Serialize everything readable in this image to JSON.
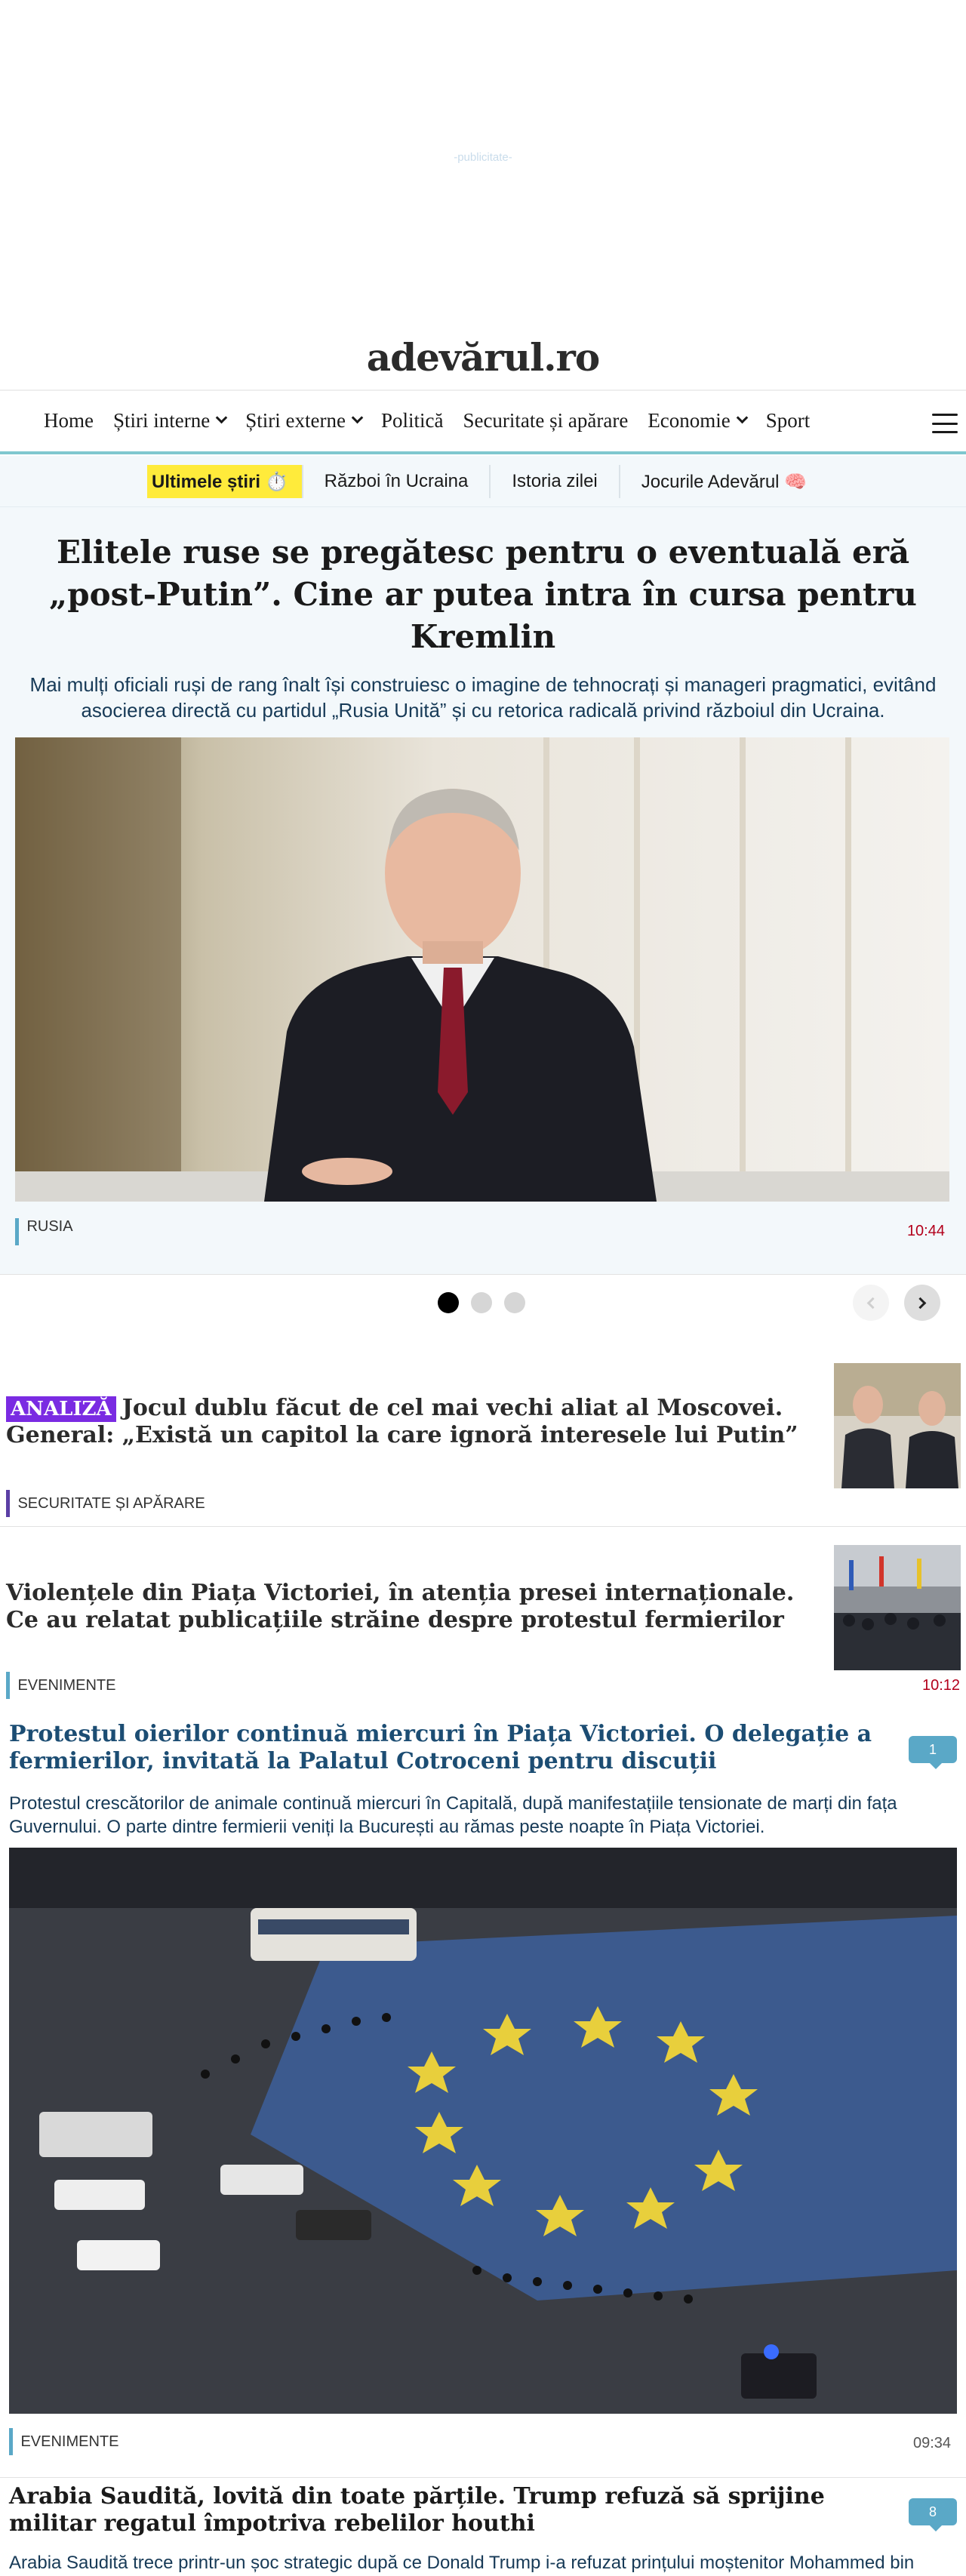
{
  "ad": {
    "label": "-publicitate-"
  },
  "site": {
    "logo": "adevărul.ro"
  },
  "nav": {
    "items": [
      {
        "label": "Home",
        "has_dropdown": false
      },
      {
        "label": "Știri interne",
        "has_dropdown": true
      },
      {
        "label": "Știri externe",
        "has_dropdown": true
      },
      {
        "label": "Politică",
        "has_dropdown": false
      },
      {
        "label": "Securitate și apărare",
        "has_dropdown": false
      },
      {
        "label": "Economie",
        "has_dropdown": true
      },
      {
        "label": "Sport",
        "has_dropdown": false
      }
    ]
  },
  "subnav": {
    "items": [
      "Ultimele știri ⏱️",
      "Război în Ucraina",
      "Istoria zilei",
      "Jocurile Adevărul 🧠"
    ]
  },
  "hero": {
    "title": "Elitele ruse se pregătesc pentru o eventuală eră „post-Putin”. Cine ar putea intra în cursa pentru Kremlin",
    "lead": "Mai mulți oficiali ruși de rang înalt își construiesc o imagine de tehnocrați și manageri pragmatici, evitând asocierea directă cu partidul „Rusia Unită” și cu retorica radicală privind războiul din Ucraina.",
    "category": "RUSIA",
    "time": "10:44"
  },
  "carousel": {
    "dot_count": 3,
    "active_index": 0
  },
  "articles": [
    {
      "badge": "ANALIZĂ",
      "title": "Jocul dublu făcut de cel mai vechi aliat al Moscovei. General: „Există un capitol la care ignoră interesele lui Putin”",
      "category": "SECURITATE ȘI APĂRARE",
      "category_color": "#5b3fa5"
    },
    {
      "title": "Violențele din Piața Victoriei, în atenția presei internaționale. Ce au relatat publicațiile străine despre protestul fermierilor",
      "category": "EVENIMENTE",
      "category_color": "#5aa8c7",
      "time": "10:12"
    }
  ],
  "stories": [
    {
      "title": "Protestul oierilor continuă miercuri în Piața Victoriei. O delegație a fermierilor, invitată la Palatul Cotroceni pentru discuții",
      "title_color": "#1c4d73",
      "comments": "1",
      "lead": "Protestul crescătorilor de animale continuă miercuri în Capitală, după manifestațiile tensionate de marți din fața Guvernului. O parte dintre fermierii veniți la București au rămas peste noapte în Piața Victoriei.",
      "category": "EVENIMENTE",
      "category_color": "#5aa8c7",
      "time": "09:34"
    },
    {
      "title": "Arabia Saudită, lovită din toate părțile. Trump refuză să sprijine militar regatul împotriva rebelilor houthi",
      "title_color": "#1a1a1a",
      "comments": "8",
      "lead": "Arabia Saudită trece printr-un șoc strategic după ce Donald Trump i-a refuzat prințului moștenitor Mohammed bin"
    }
  ],
  "colors": {
    "accent_teal": "#7fc7cf",
    "time_red": "#b3001b",
    "highlight_yellow": "#ffeb3b",
    "analiza_purple": "#7a2be2"
  }
}
